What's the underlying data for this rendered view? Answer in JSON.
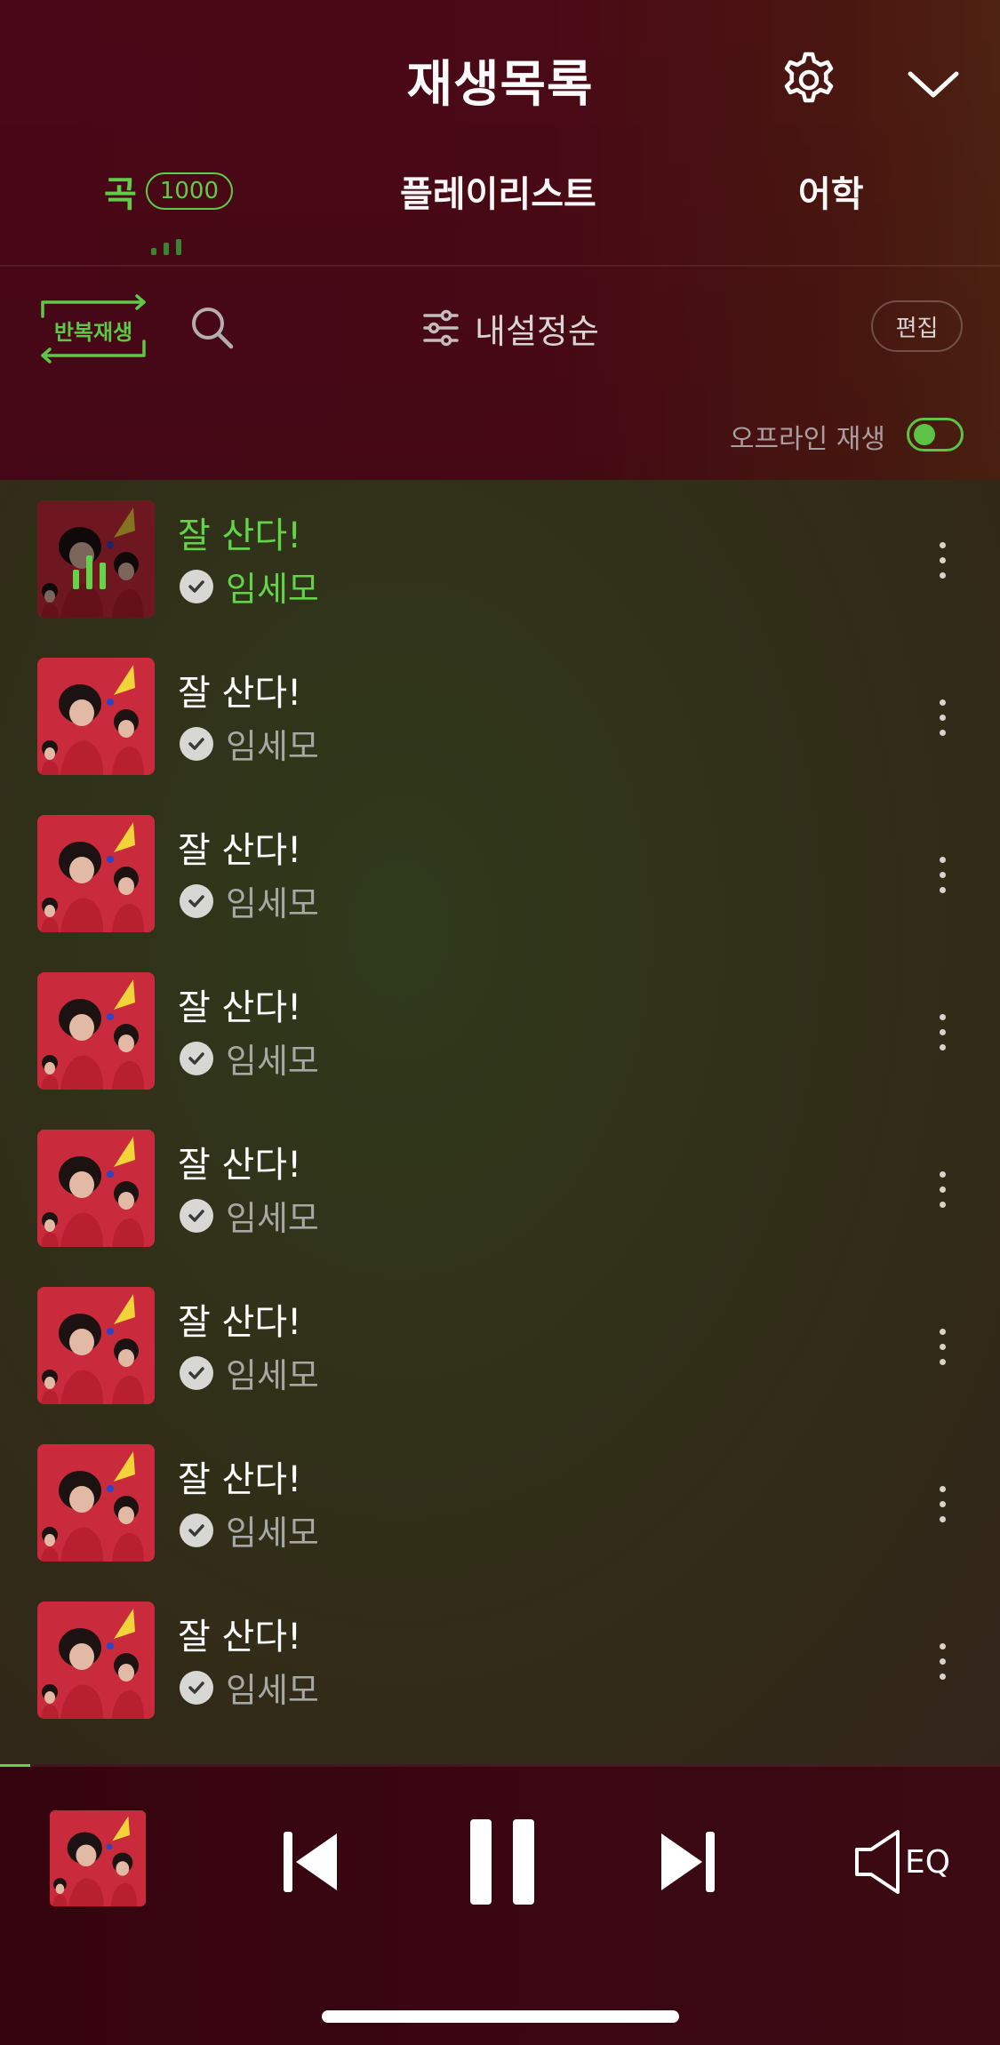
{
  "header": {
    "title": "재생목록",
    "settings_icon": "gear-icon",
    "collapse_icon": "chevron-down-icon"
  },
  "tabs": {
    "songs_label": "곡",
    "songs_count": "1000",
    "playlist_label": "플레이리스트",
    "language_label": "어학",
    "active": "songs"
  },
  "toolbar": {
    "repeat_label": "반복재생",
    "sort_label": "내설정순",
    "edit_label": "편집"
  },
  "offline": {
    "label": "오프라인 재생",
    "enabled": true
  },
  "songs": [
    {
      "title": "잘 산다!",
      "artist": "임세모",
      "playing": true
    },
    {
      "title": "잘 산다!",
      "artist": "임세모",
      "playing": false
    },
    {
      "title": "잘 산다!",
      "artist": "임세모",
      "playing": false
    },
    {
      "title": "잘 산다!",
      "artist": "임세모",
      "playing": false
    },
    {
      "title": "잘 산다!",
      "artist": "임세모",
      "playing": false
    },
    {
      "title": "잘 산다!",
      "artist": "임세모",
      "playing": false
    },
    {
      "title": "잘 산다!",
      "artist": "임세모",
      "playing": false
    },
    {
      "title": "잘 산다!",
      "artist": "임세모",
      "playing": false
    }
  ],
  "player": {
    "progress": 0.03,
    "eq_label": "EQ",
    "state": "playing"
  },
  "colors": {
    "accent": "#63d34a",
    "header_bg": "#4a0717",
    "list_bg": "#30321a",
    "player_bg": "#36040f"
  }
}
